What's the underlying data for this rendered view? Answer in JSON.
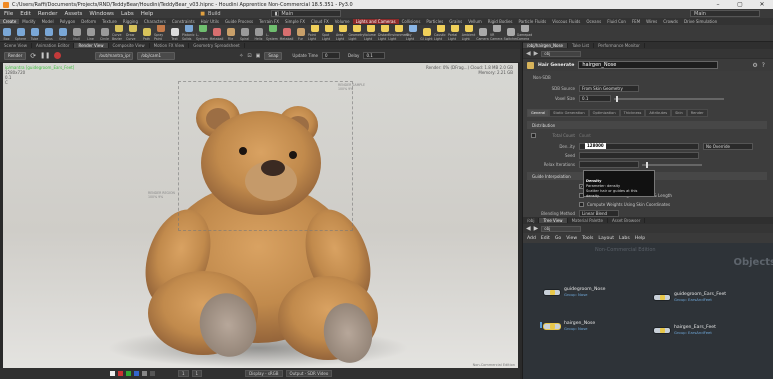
{
  "window": {
    "title": "C:/Users/Raffi/Documents/Projects/RND/TeddyBear/Houdini/TeddyBear_v03.hipnc - Houdini Apprentice Non-Commercial 18.5.351 - Py3.0",
    "controls": [
      "–",
      "▢",
      "✕"
    ]
  },
  "menubar": {
    "items": [
      "File",
      "Edit",
      "Render",
      "Assets",
      "Windows",
      "Labs",
      "Help"
    ],
    "build_label": "Build",
    "desktop_left": "Main",
    "desktop_right": "Main"
  },
  "shelf_tabs": [
    {
      "label": "Create",
      "state": "active"
    },
    {
      "label": "Modify",
      "state": ""
    },
    {
      "label": "Model",
      "state": ""
    },
    {
      "label": "Polygon",
      "state": ""
    },
    {
      "label": "Deform",
      "state": ""
    },
    {
      "label": "Texture",
      "state": ""
    },
    {
      "label": "Rigging",
      "state": ""
    },
    {
      "label": "Characters",
      "state": ""
    },
    {
      "label": "Constraints",
      "state": ""
    },
    {
      "label": "Hair Utils",
      "state": ""
    },
    {
      "label": "Guide Process",
      "state": ""
    },
    {
      "label": "Terrain FX",
      "state": ""
    },
    {
      "label": "Simple FX",
      "state": ""
    },
    {
      "label": "Cloud FX",
      "state": ""
    },
    {
      "label": "Volume",
      "state": ""
    },
    {
      "label": "Lights and Cameras",
      "state": "red"
    },
    {
      "label": "Collisions",
      "state": ""
    },
    {
      "label": "Particles",
      "state": ""
    },
    {
      "label": "Grains",
      "state": ""
    },
    {
      "label": "Vellum",
      "state": ""
    },
    {
      "label": "Rigid Bodies",
      "state": ""
    },
    {
      "label": "Particle Fluids",
      "state": ""
    },
    {
      "label": "Viscous Fluids",
      "state": ""
    },
    {
      "label": "Oceans",
      "state": ""
    },
    {
      "label": "Fluid Con",
      "state": ""
    },
    {
      "label": "FEM",
      "state": ""
    },
    {
      "label": "Wires",
      "state": ""
    },
    {
      "label": "Crowds",
      "state": ""
    },
    {
      "label": "Drive Simulation",
      "state": ""
    }
  ],
  "shelf_tools": [
    {
      "label": "Box",
      "color": "#7aa7d6"
    },
    {
      "label": "Sphere",
      "color": "#7aa7d6"
    },
    {
      "label": "Tube",
      "color": "#7aa7d6"
    },
    {
      "label": "Torus",
      "color": "#7aa7d6"
    },
    {
      "label": "Grid",
      "color": "#7aa7d6"
    },
    {
      "label": "Null",
      "color": "#9a9a9a"
    },
    {
      "label": "Line",
      "color": "#9a9a9a"
    },
    {
      "label": "Circle",
      "color": "#9a9a9a"
    },
    {
      "label": "Curve Bezier",
      "color": "#d7c25a"
    },
    {
      "label": "Draw Curve",
      "color": "#d7c25a"
    },
    {
      "label": "Path",
      "color": "#d7c25a"
    },
    {
      "label": "Spray Paint",
      "color": "#c47a4a"
    },
    {
      "label": "Text",
      "color": "#dddddd"
    },
    {
      "label": "Platonic Solids",
      "color": "#7aa7d6"
    },
    {
      "label": "L-System",
      "color": "#6fbf6f"
    },
    {
      "label": "Metaball",
      "color": "#d86f6f"
    },
    {
      "label": "File",
      "color": "#c9a06a"
    },
    {
      "label": "Spiral",
      "color": "#9a9a9a"
    },
    {
      "label": "Helix",
      "color": "#9a9a9a"
    },
    {
      "label": "L-System",
      "color": "#6fbf6f"
    },
    {
      "label": "Metaball",
      "color": "#d86f6f"
    },
    {
      "label": "Fur",
      "color": "#c9a06a"
    },
    {
      "label": "Point Light",
      "color": "#f0d05a"
    },
    {
      "label": "Spot Light",
      "color": "#f0d05a"
    },
    {
      "label": "Area Light",
      "color": "#f0d05a"
    },
    {
      "label": "Geometry Light",
      "color": "#f0d05a"
    },
    {
      "label": "Volume Light",
      "color": "#f0d05a"
    },
    {
      "label": "Distant Light",
      "color": "#f0d05a"
    },
    {
      "label": "Environment Light",
      "color": "#f0d05a"
    },
    {
      "label": "Sky Light",
      "color": "#8ab6e6"
    },
    {
      "label": "GI Light",
      "color": "#f0d05a"
    },
    {
      "label": "Caustic Light",
      "color": "#f0d05a"
    },
    {
      "label": "Portal Light",
      "color": "#f0d05a"
    },
    {
      "label": "Ambient Light",
      "color": "#f0d05a"
    },
    {
      "label": "Camera",
      "color": "#aaaaaa"
    },
    {
      "label": "VR Camera",
      "color": "#aaaaaa"
    },
    {
      "label": "Switcher",
      "color": "#aaaaaa"
    },
    {
      "label": "Gamepad Camera",
      "color": "#aaaaaa"
    }
  ],
  "left_panel_tabs": [
    {
      "label": "Scene View",
      "active": false
    },
    {
      "label": "Animation Editor",
      "active": false
    },
    {
      "label": "Render View",
      "active": true
    },
    {
      "label": "Composite View",
      "active": false
    },
    {
      "label": "Motion FX View",
      "active": false
    },
    {
      "label": "Geometry Spreadsheet",
      "active": false
    }
  ],
  "render_toolbar": {
    "render_btn": "Render",
    "renderer": "/out/mantra_ipr",
    "camera": "/obj/cam1",
    "shot_btn": "Snap",
    "update_time_label": "Update Time",
    "update_time_val": "0",
    "delay_label": "Delay",
    "delay_val": "0.1"
  },
  "viewport": {
    "hud_tl_line1": "ip/mantra [guidegroom_Ears_Feet]",
    "hud_tl_line2": "1280x720",
    "hud_tl_line3": "0.1",
    "hud_tl_line4": "C",
    "hud_tr_line1": "Render: 0% (DFrag...)   Cloud: 1.8 MB  2.0 GB",
    "hud_tr_line2": "Memory:   2.21 GB",
    "tag_top": "RENDER SAMPLE\n100% 9%",
    "tag_left": "RENDER REGION\n100% 9%",
    "noncommercial": "Non-Commercial Edition"
  },
  "viewport_bottom": {
    "frame": "1",
    "frame2": "1",
    "display": "Display - sRGB",
    "output": "Output - SDR Video"
  },
  "right_tabs": [
    {
      "label": "/obj/hairgen_Nose",
      "active": true
    },
    {
      "label": "Take List",
      "active": false
    },
    {
      "label": "Performance Monitor",
      "active": false
    }
  ],
  "right_path": "obj",
  "param": {
    "node_type": "Hair Generate",
    "node_name": "hairgen_Nose",
    "rows": [
      {
        "label": "Non-SDB",
        "value": ""
      },
      {
        "label": "SDB Source",
        "value": "From Skin Geometry"
      },
      {
        "label": "Voxel Size",
        "value": "0.1"
      }
    ],
    "subtabs": [
      "General",
      "Static Generation",
      "Optimization",
      "Thickness",
      "Attributes",
      "Skin",
      "Render"
    ],
    "distribution_title": "Distribution",
    "total_count_label": "Total Count",
    "total_count_val": "Count",
    "density_label": "Den..ity",
    "density_val": "128000",
    "no_override": "No Override",
    "seed_label": "Seed",
    "relax_label": "Relax Iterations",
    "guide_interp": "Guide Interpolation",
    "use_guides": "Use Guides",
    "assume_uniform": "Assume Uniform Segment Count & Length",
    "compute_weights": "Compute Weights Using Skin Coordinates",
    "blend_method_label": "Blending Method",
    "blend_method_val": "Linear Blend",
    "tooltip_title": "Density",
    "tooltip_line1": "Parameter: density",
    "tooltip_line2": "Scatter hair or guides at this density."
  },
  "network_tabs": [
    {
      "label": "/obj",
      "active": false
    },
    {
      "label": "Tree View",
      "active": true
    },
    {
      "label": "Material Palette",
      "active": false
    },
    {
      "label": "Asset Browser",
      "active": false
    }
  ],
  "network_path": "obj",
  "network_menu": [
    "Add",
    "Edit",
    "Go",
    "View",
    "Tools",
    "Layout",
    "Labs",
    "Help"
  ],
  "network": {
    "watermark": "Non-Commercial Edition",
    "context_label": "Objects",
    "nodes": [
      {
        "name": "guidegroom_Nose",
        "group": "Group: Nose"
      },
      {
        "name": "guidegroom_Ears_Feet",
        "group": "Group: EarsAndFeet"
      },
      {
        "name": "hairgen_Nose",
        "group": "Group: Nose"
      },
      {
        "name": "hairgen_Ears_Feet",
        "group": "Group: EarsAndFeet"
      }
    ]
  },
  "colors": {
    "accent_red": "#c33a3a",
    "node_yellow": "#e7c74a",
    "group_blue": "#6fa7d8"
  }
}
